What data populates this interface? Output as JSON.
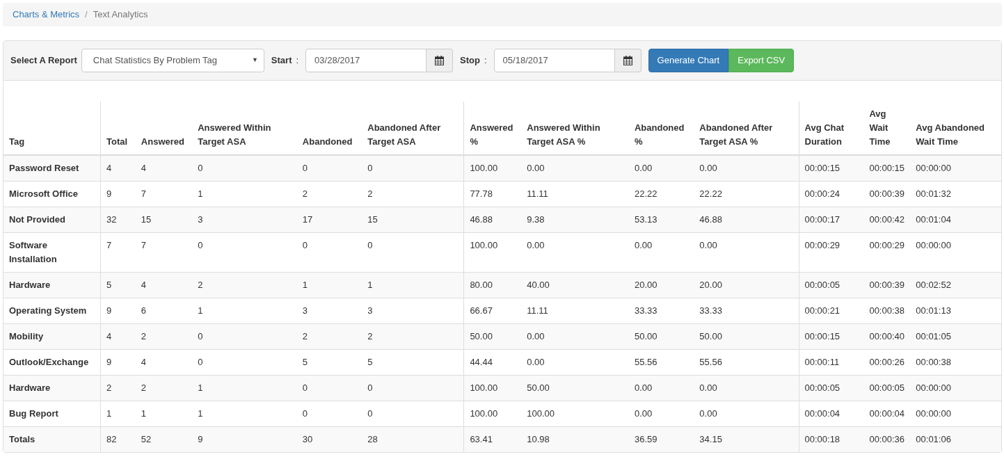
{
  "breadcrumb": [
    {
      "label": "Charts & Metrics",
      "kind": "link"
    },
    {
      "label": "/",
      "kind": "separator"
    },
    {
      "label": "Text Analytics",
      "kind": "current"
    }
  ],
  "filters": {
    "report_label": "Select A Report",
    "report_value": "Chat Statistics By Problem Tag",
    "report_caret": "▼",
    "start_label": "Start",
    "start_sep": ":",
    "start_value": "03/28/2017",
    "stop_label": "Stop",
    "stop_sep": ":",
    "stop_value": "05/18/2017"
  },
  "buttons": [
    {
      "label": "Generate Chart",
      "kind": "primary"
    },
    {
      "label": "Export CSV",
      "kind": "success"
    }
  ],
  "table": {
    "columns": [
      {
        "label": "Tag",
        "divider_after": true
      },
      {
        "label": "Total",
        "divider_after": false
      },
      {
        "label": "Answered",
        "divider_after": false
      },
      {
        "label": "Answered Within Target ASA",
        "divider_after": false
      },
      {
        "label": "Abandoned",
        "divider_after": false
      },
      {
        "label": "Abandoned After Target ASA",
        "divider_after": true
      },
      {
        "label": "Answered %",
        "divider_after": false
      },
      {
        "label": "Answered Within Target ASA %",
        "divider_after": false
      },
      {
        "label": "Abandoned %",
        "divider_after": false
      },
      {
        "label": "Abandoned After Target ASA %",
        "divider_after": true
      },
      {
        "label": "Avg Chat Duration",
        "divider_after": false
      },
      {
        "label": "Avg Wait Time",
        "divider_after": false
      },
      {
        "label": "Avg Abandoned Wait Time",
        "divider_after": false
      }
    ],
    "rows": [
      [
        "Password Reset",
        "4",
        "4",
        "0",
        "0",
        "0",
        "100.00",
        "0.00",
        "0.00",
        "0.00",
        "00:00:15",
        "00:00:15",
        "00:00:00"
      ],
      [
        "Microsoft Office",
        "9",
        "7",
        "1",
        "2",
        "2",
        "77.78",
        "11.11",
        "22.22",
        "22.22",
        "00:00:24",
        "00:00:39",
        "00:01:32"
      ],
      [
        "Not Provided",
        "32",
        "15",
        "3",
        "17",
        "15",
        "46.88",
        "9.38",
        "53.13",
        "46.88",
        "00:00:17",
        "00:00:42",
        "00:01:04"
      ],
      [
        "Software Installation",
        "7",
        "7",
        "0",
        "0",
        "0",
        "100.00",
        "0.00",
        "0.00",
        "0.00",
        "00:00:29",
        "00:00:29",
        "00:00:00"
      ],
      [
        "Hardware",
        "5",
        "4",
        "2",
        "1",
        "1",
        "80.00",
        "40.00",
        "20.00",
        "20.00",
        "00:00:05",
        "00:00:39",
        "00:02:52"
      ],
      [
        "Operating System",
        "9",
        "6",
        "1",
        "3",
        "3",
        "66.67",
        "11.11",
        "33.33",
        "33.33",
        "00:00:21",
        "00:00:38",
        "00:01:13"
      ],
      [
        "Mobility",
        "4",
        "2",
        "0",
        "2",
        "2",
        "50.00",
        "0.00",
        "50.00",
        "50.00",
        "00:00:15",
        "00:00:40",
        "00:01:05"
      ],
      [
        "Outlook/Exchange",
        "9",
        "4",
        "0",
        "5",
        "5",
        "44.44",
        "0.00",
        "55.56",
        "55.56",
        "00:00:11",
        "00:00:26",
        "00:00:38"
      ],
      [
        "Hardware",
        "2",
        "2",
        "1",
        "0",
        "0",
        "100.00",
        "50.00",
        "0.00",
        "0.00",
        "00:00:05",
        "00:00:05",
        "00:00:00"
      ],
      [
        "Bug Report",
        "1",
        "1",
        "1",
        "0",
        "0",
        "100.00",
        "100.00",
        "0.00",
        "0.00",
        "00:00:04",
        "00:00:04",
        "00:00:00"
      ],
      [
        "Totals",
        "82",
        "52",
        "9",
        "30",
        "28",
        "63.41",
        "10.98",
        "36.59",
        "34.15",
        "00:00:18",
        "00:00:36",
        "00:01:06"
      ]
    ]
  }
}
